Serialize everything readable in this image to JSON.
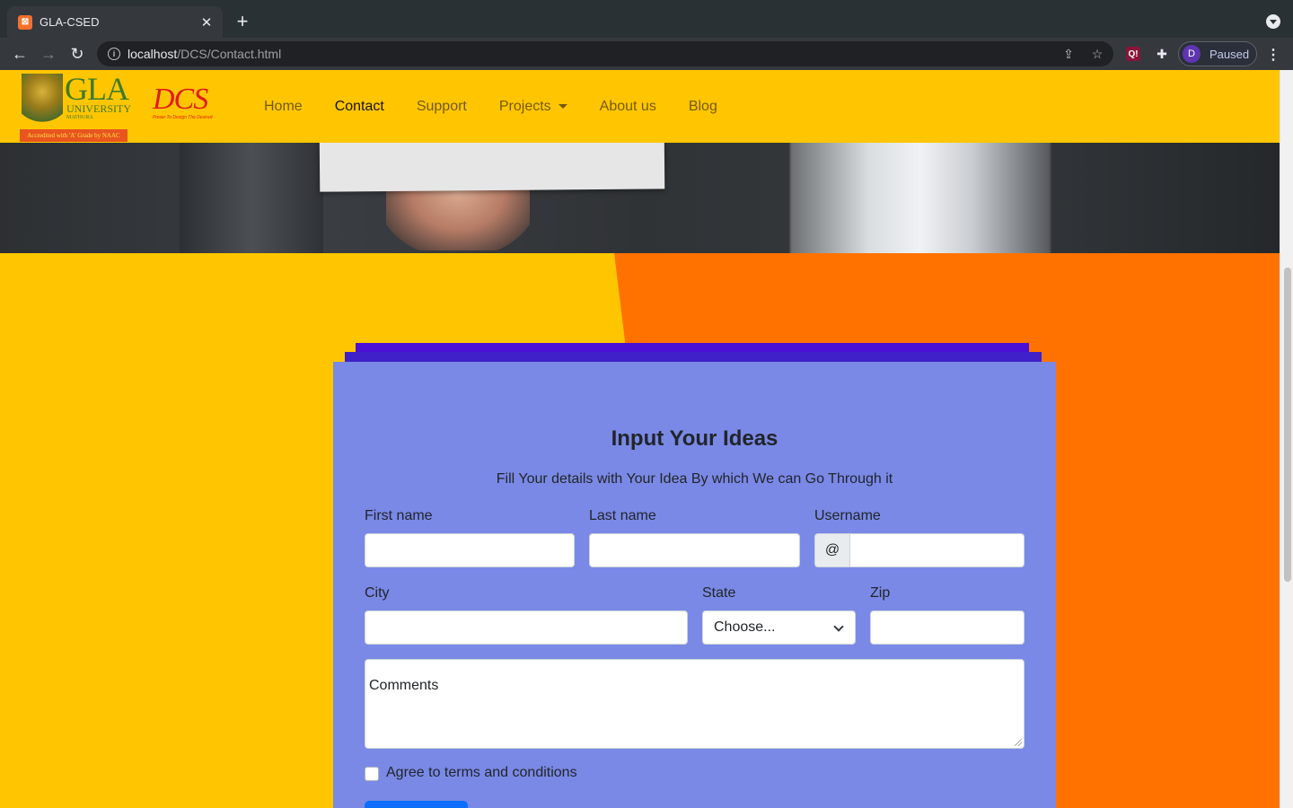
{
  "browser": {
    "tab_title": "GLA-CSED",
    "tab_close": "✕",
    "new_tab": "+",
    "url_host": "localhost",
    "url_path": "/DCS/Contact.html",
    "profile_initial": "D",
    "profile_status": "Paused"
  },
  "site": {
    "logo_gla_main": "GLA",
    "logo_gla_university": "UNIVERSITY",
    "logo_gla_city": "MATHURA",
    "logo_gla_accreditation": "Accredited with 'A' Grade by NAAC",
    "logo_dcs": "DCS",
    "logo_dcs_tagline": "Power To Design The Desired",
    "nav": {
      "home": "Home",
      "contact": "Contact",
      "support": "Support",
      "projects": "Projects",
      "about": "About us",
      "blog": "Blog"
    },
    "accent_colors": {
      "navbar": "#ffc600",
      "orange": "#ff7200",
      "form_bg": "#7a89e6",
      "stack_top": "#4b10d6"
    }
  },
  "form": {
    "title": "Input Your Ideas",
    "subtitle": "Fill Your details with Your Idea By which We can Go Through it",
    "first_name_label": "First name",
    "last_name_label": "Last name",
    "username_label": "Username",
    "username_prefix": "@",
    "city_label": "City",
    "state_label": "State",
    "state_selected": "Choose...",
    "zip_label": "Zip",
    "comments_placeholder": "Comments",
    "agree_label": "Agree to terms and conditions"
  }
}
